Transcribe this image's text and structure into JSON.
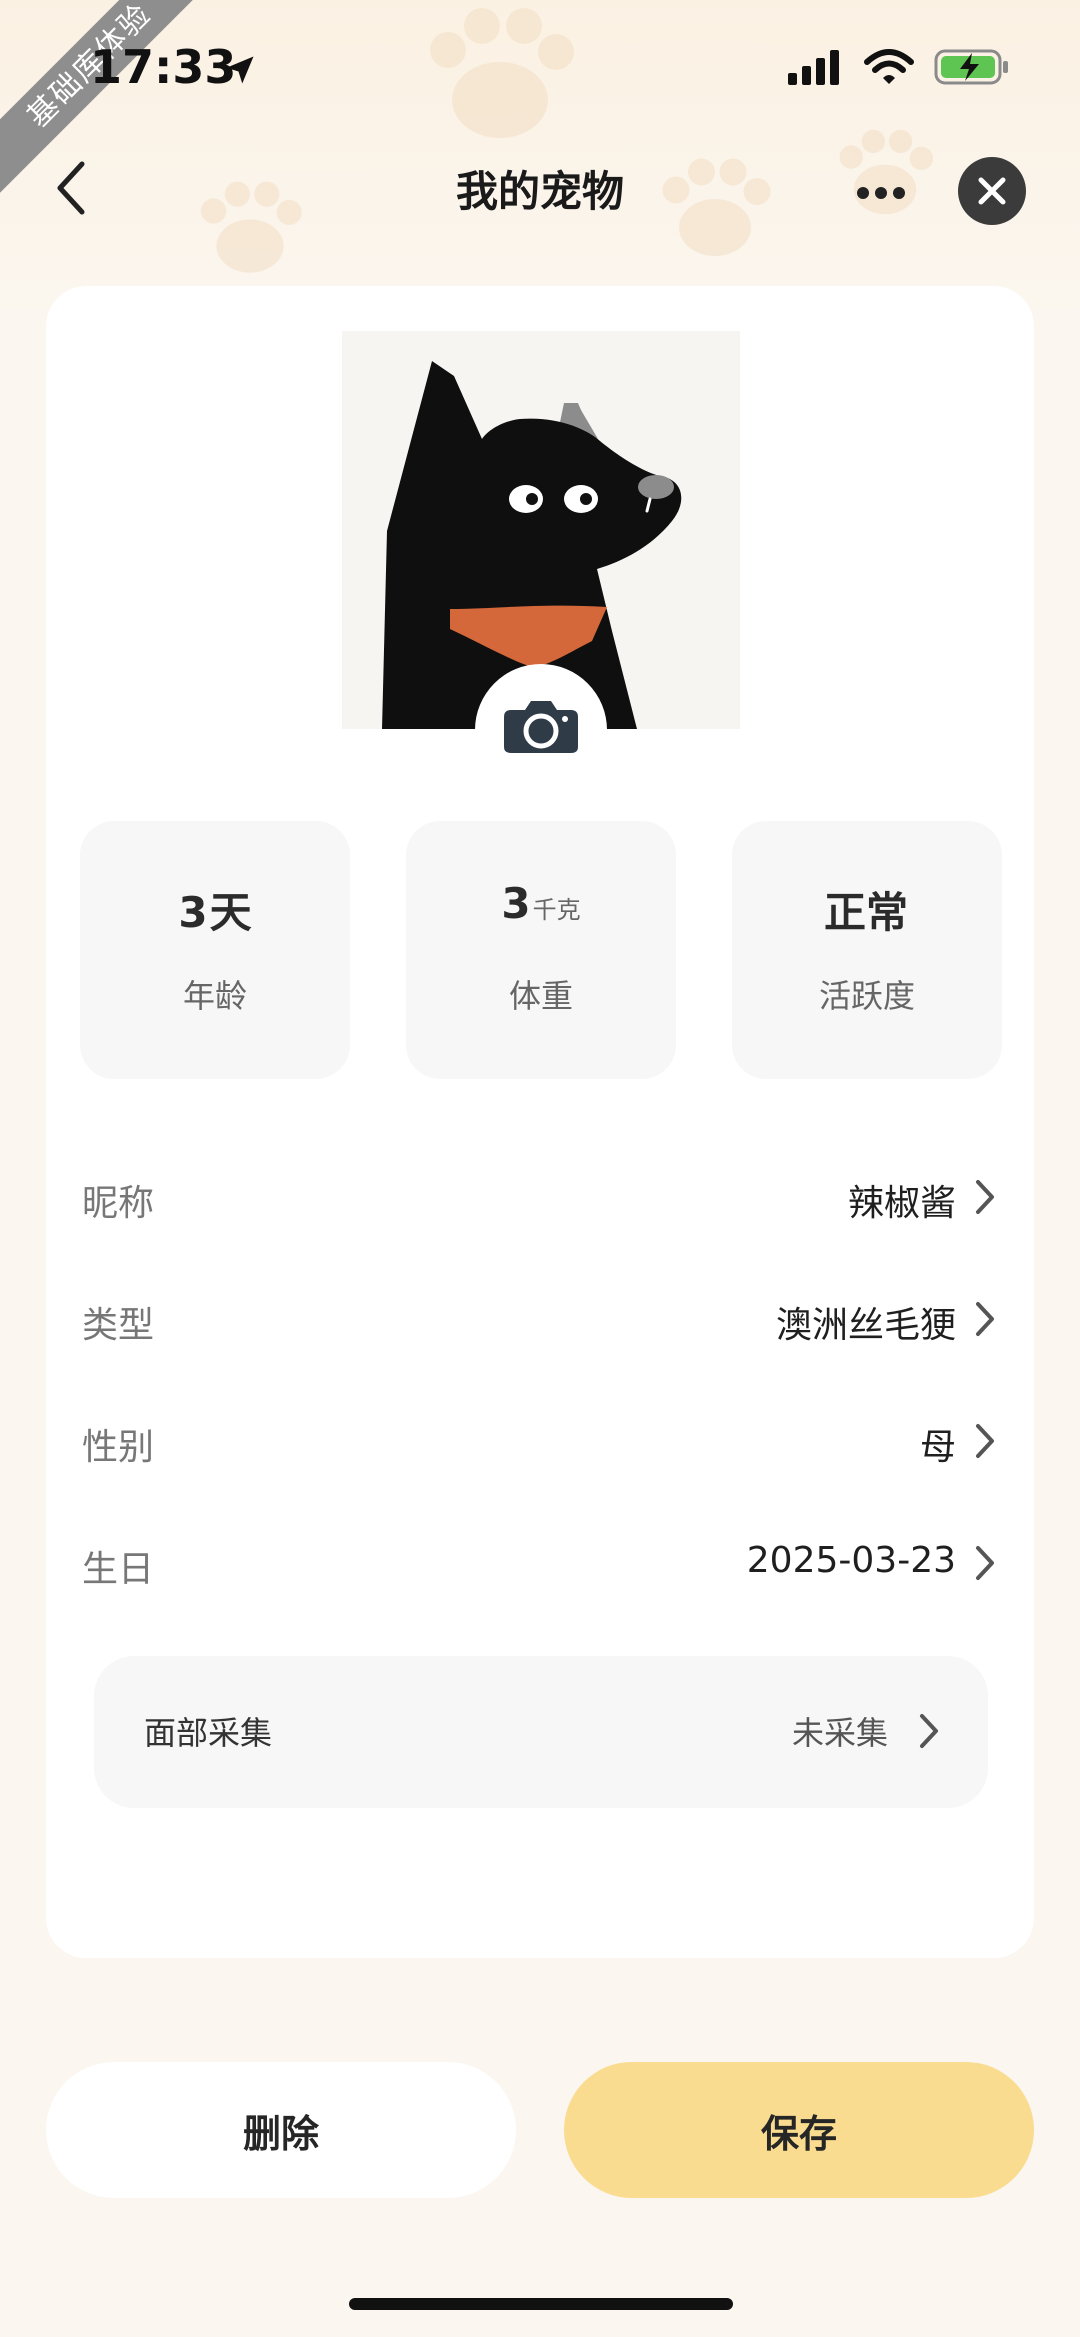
{
  "ribbon_text": "基础库体验",
  "status_bar": {
    "time": "17:33",
    "icons": [
      "location-arrow-icon",
      "signal-icon",
      "wifi-icon",
      "battery-charging-icon"
    ]
  },
  "nav": {
    "title": "我的宠物",
    "icons": [
      "chevron-left-icon",
      "more-icon",
      "close-icon"
    ]
  },
  "colors": {
    "background": "#fbf6ef",
    "card": "#ffffff",
    "save_button": "#f9dc8f",
    "close_button": "#3b3b3b",
    "collar": "#d5683a"
  },
  "pet_avatar": {
    "icon": "camera-icon"
  },
  "stats": [
    {
      "value": "3",
      "unit": "天",
      "label": "年龄"
    },
    {
      "value": "3",
      "unit": "千克",
      "label": "体重"
    },
    {
      "value": "正常",
      "unit": "",
      "label": "活跃度"
    }
  ],
  "fields": [
    {
      "label": "昵称",
      "value": "辣椒酱"
    },
    {
      "label": "类型",
      "value": "澳洲丝毛㹴"
    },
    {
      "label": "性别",
      "value": "母"
    },
    {
      "label": "生日",
      "value": "2025-03-23"
    }
  ],
  "face_capture": {
    "label": "面部采集",
    "value": "未采集"
  },
  "buttons": {
    "delete": "删除",
    "save": "保存"
  }
}
